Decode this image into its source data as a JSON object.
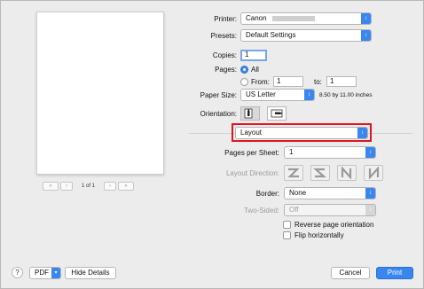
{
  "preview": {
    "page_label": "1 of 1"
  },
  "pager": {
    "first": "«",
    "prev": "‹",
    "next": "›",
    "last": "»"
  },
  "printer": {
    "label": "Printer:",
    "value": "Canon"
  },
  "presets": {
    "label": "Presets:",
    "value": "Default Settings"
  },
  "copies": {
    "label": "Copies:",
    "value": "1"
  },
  "pages": {
    "label": "Pages:",
    "all_label": "All",
    "from_label": "From:",
    "from_value": "1",
    "to_label": "to:",
    "to_value": "1",
    "selected": "All"
  },
  "paper_size": {
    "label": "Paper Size:",
    "value": "US Letter",
    "dimensions": "8.50 by 11.00 inches"
  },
  "orientation": {
    "label": "Orientation:",
    "selected": "portrait"
  },
  "section": {
    "value": "Layout"
  },
  "layout": {
    "pages_per_sheet": {
      "label": "Pages per Sheet:",
      "value": "1"
    },
    "layout_direction": {
      "label": "Layout Direction:",
      "options": [
        "Z",
        "S",
        "N",
        "N"
      ]
    },
    "border": {
      "label": "Border:",
      "value": "None"
    },
    "two_sided": {
      "label": "Two-Sided:",
      "value": "Off"
    },
    "reverse_orientation_label": "Reverse page orientation",
    "flip_horizontally_label": "Flip horizontally"
  },
  "footer": {
    "help": "?",
    "pdf_label": "PDF",
    "hide_details": "Hide Details",
    "cancel": "Cancel",
    "print": "Print"
  },
  "colors": {
    "accent": "#3a86f0",
    "highlight": "#e0151d"
  }
}
